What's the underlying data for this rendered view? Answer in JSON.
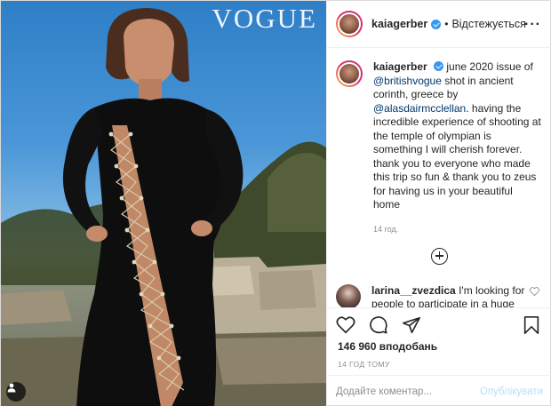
{
  "photo": {
    "magazine_logo": "VOGUE",
    "tag_icon": "user-tag-icon"
  },
  "header": {
    "username": "kaiagerber",
    "separator": "•",
    "follow_status": "Відстежується",
    "more_icon": "more-options-icon"
  },
  "caption": {
    "username": "kaiagerber",
    "text_1": "june 2020 issue of",
    "mention_1": "@britishvogue",
    "text_2": "shot in ancient corinth, greece by",
    "mention_2": "@alasdairmcclellan",
    "text_3": ". having the incredible experience of shooting at the temple of olympian is something I will cherish forever. thank you to everyone who made this trip so fun & thank you to zeus for having us in your beautiful home",
    "age": "14 год."
  },
  "comments": [
    {
      "username": "larina__zvezdica",
      "text": "I'm looking for people to participate in a huge book exchange. You can be anywhere in the world. All you have to do is buy your favorite"
    }
  ],
  "actions": {
    "likes": "146 960 вподобань",
    "posted": "14 ГОД ТОМУ",
    "comment_placeholder": "Додайте коментар...",
    "post_label": "Опублікувати"
  },
  "colors": {
    "link": "#00376b",
    "verified": "#3897f0",
    "post_disabled": "#b2dffc",
    "muted": "#8e8e8e"
  }
}
